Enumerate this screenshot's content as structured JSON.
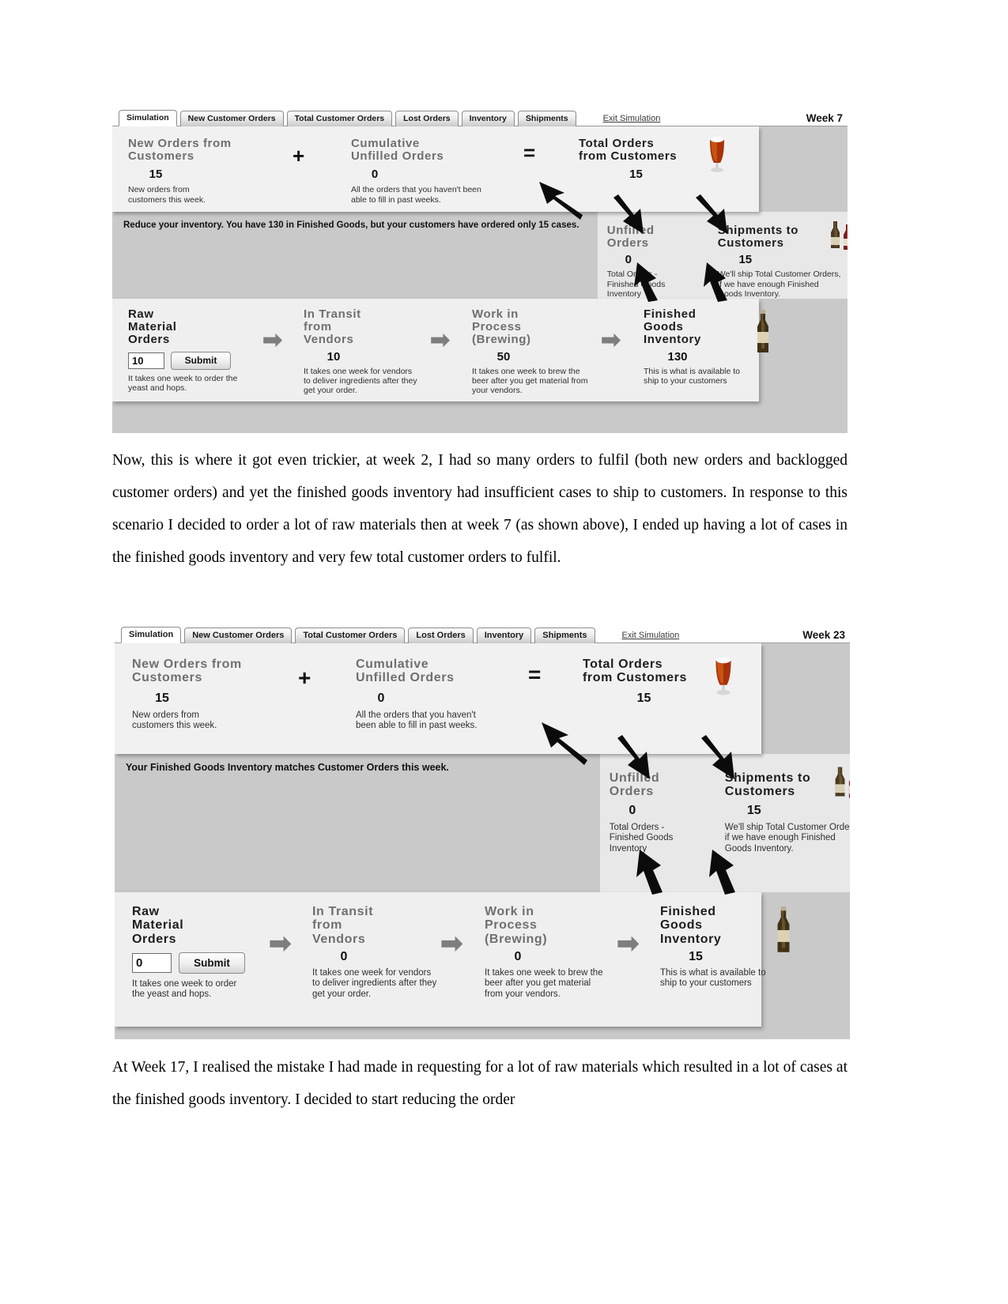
{
  "tabs": [
    "Simulation",
    "New Customer Orders",
    "Total Customer Orders",
    "Lost Orders",
    "Inventory",
    "Shipments"
  ],
  "exit_label": "Exit Simulation",
  "panel1": {
    "week_label": "Week 7",
    "new_orders": {
      "title": "New Orders from\nCustomers",
      "title_line1": "New Orders from",
      "title_line2": "Customers",
      "value": "15",
      "desc": "New orders from customers this week."
    },
    "operator_plus": "+",
    "cumulative": {
      "title_line1": "Cumulative",
      "title_line2": "Unfilled Orders",
      "value": "0",
      "desc": "All the orders that you haven't been able to fill in past weeks."
    },
    "operator_equals": "=",
    "total_orders": {
      "title_line1": "Total Orders",
      "title_line2": "from Customers",
      "value": "15"
    },
    "message": "Reduce your inventory. You have 130 in Finished Goods, but your customers have ordered only 15 cases.",
    "unfilled": {
      "title_line1": "Unfilled",
      "title_line2": "Orders",
      "value": "0",
      "desc": "Total Orders - Finished Goods Inventory"
    },
    "shipments": {
      "title_line1": "Shipments to",
      "title_line2": "Customers",
      "value": "15",
      "desc": "We'll ship Total Customer Orders, if we have enough Finished Goods Inventory."
    },
    "raw_material": {
      "title_line1": "Raw",
      "title_line2": "Material",
      "title_line3": "Orders",
      "input_value": "10",
      "submit_label": "Submit",
      "desc": "It takes one week to order the yeast and hops."
    },
    "in_transit": {
      "title_line1": "In Transit",
      "title_line2": "from",
      "title_line3": "Vendors",
      "value": "10",
      "desc": "It takes one week for vendors to deliver ingredients after they get your order."
    },
    "work_in_process": {
      "title_line1": "Work in",
      "title_line2": "Process",
      "title_line3": "(Brewing)",
      "value": "50",
      "desc": "It takes one week to brew the beer after you get material from your vendors."
    },
    "finished_goods": {
      "title_line1": "Finished",
      "title_line2": "Goods",
      "title_line3": "Inventory",
      "value": "130",
      "desc": "This is what is available to ship to your customers"
    }
  },
  "panel2": {
    "week_label": "Week 23",
    "new_orders": {
      "title_line1": "New Orders from",
      "title_line2": "Customers",
      "value": "15",
      "desc": "New orders from customers this week."
    },
    "operator_plus": "+",
    "cumulative": {
      "title_line1": "Cumulative",
      "title_line2": "Unfilled Orders",
      "value": "0",
      "desc": "All the orders that you haven't been able to fill in past weeks."
    },
    "operator_equals": "=",
    "total_orders": {
      "title_line1": "Total Orders",
      "title_line2": "from Customers",
      "value": "15"
    },
    "message": "Your Finished Goods Inventory matches Customer Orders this week.",
    "unfilled": {
      "title_line1": "Unfilled",
      "title_line2": "Orders",
      "value": "0",
      "desc": "Total Orders - Finished Goods Inventory"
    },
    "shipments": {
      "title_line1": "Shipments to",
      "title_line2": "Customers",
      "value": "15",
      "desc": "We'll ship Total Customer Orders, if we have enough Finished Goods Inventory."
    },
    "raw_material": {
      "title_line1": "Raw",
      "title_line2": "Material",
      "title_line3": "Orders",
      "input_value": "0",
      "submit_label": "Submit",
      "desc": "It takes one week to order the yeast and hops."
    },
    "in_transit": {
      "title_line1": "In Transit",
      "title_line2": "from",
      "title_line3": "Vendors",
      "value": "0",
      "desc": "It takes one week for vendors to deliver ingredients after they get your order."
    },
    "work_in_process": {
      "title_line1": "Work in",
      "title_line2": "Process",
      "title_line3": "(Brewing)",
      "value": "0",
      "desc": "It takes one week to brew the beer after you get material from your vendors."
    },
    "finished_goods": {
      "title_line1": "Finished",
      "title_line2": "Goods",
      "title_line3": "Inventory",
      "value": "15",
      "desc": "This is what is available to ship to your customers"
    }
  },
  "document": {
    "paragraph1": "Now, this is where it got even trickier, at week 2, I had so many orders to fulfil (both new orders and backlogged customer orders) and yet the finished goods inventory had insufficient cases to ship to customers. In response to this scenario I decided to order a lot of raw materials then at week 7 (as shown above), I ended up having a lot of cases in the finished goods inventory and very few total customer orders to fulfil.",
    "paragraph2": "At Week 17, I realised the mistake I had made in requesting for a lot of raw materials which resulted in a lot of cases at the finished goods inventory. I decided to start reducing the order"
  }
}
